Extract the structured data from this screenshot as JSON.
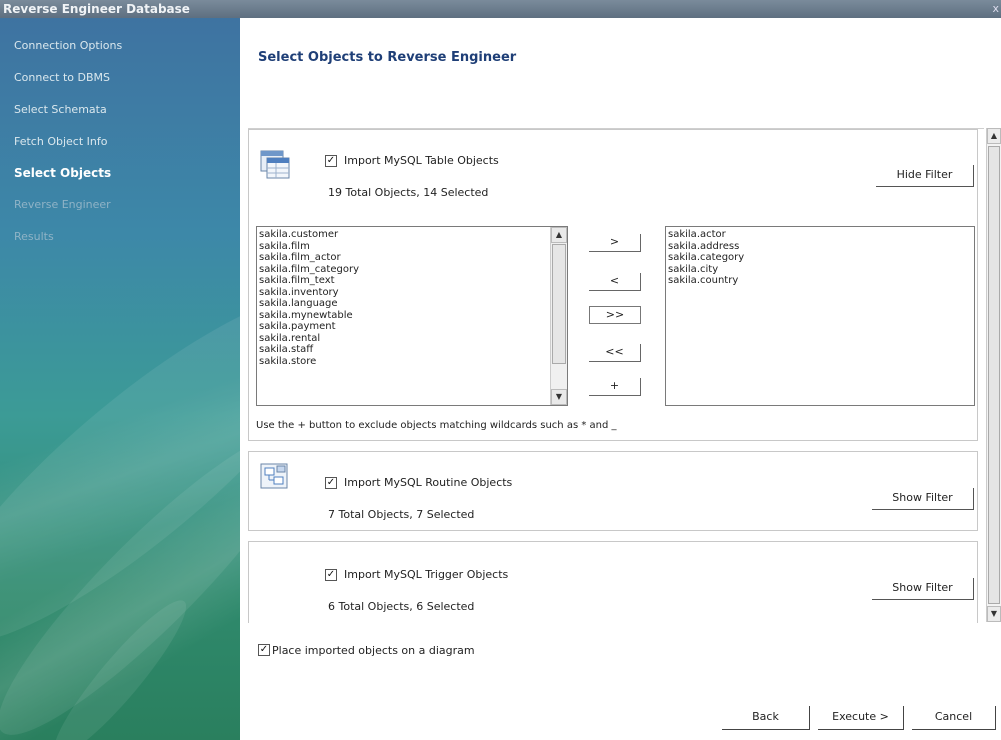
{
  "window": {
    "title": "Reverse Engineer Database",
    "close_glyph": "x"
  },
  "sidebar": {
    "items": [
      {
        "label": "Connection Options",
        "state": "done"
      },
      {
        "label": "Connect to DBMS",
        "state": "done"
      },
      {
        "label": "Select Schemata",
        "state": "done"
      },
      {
        "label": "Fetch Object Info",
        "state": "done"
      },
      {
        "label": "Select Objects",
        "state": "active"
      },
      {
        "label": "Reverse Engineer",
        "state": "pending"
      },
      {
        "label": "Results",
        "state": "pending"
      }
    ]
  },
  "main": {
    "title": "Select Objects to Reverse Engineer"
  },
  "tables_section": {
    "checkbox_label": "Import MySQL Table Objects",
    "checked": true,
    "count_text": "19 Total Objects, 14 Selected",
    "filter_button": "Hide Filter",
    "available": [
      "sakila.customer",
      "sakila.film",
      "sakila.film_actor",
      "sakila.film_category",
      "sakila.film_text",
      "sakila.inventory",
      "sakila.language",
      "sakila.mynewtable",
      "sakila.payment",
      "sakila.rental",
      "sakila.staff",
      "sakila.store"
    ],
    "selected": [
      "sakila.actor",
      "sakila.address",
      "sakila.category",
      "sakila.city",
      "sakila.country"
    ],
    "move_buttons": {
      "add": ">",
      "remove": "<",
      "add_all": ">>",
      "remove_all": "<<",
      "exclude": "+"
    },
    "hint": "Use the + button to exclude objects matching wildcards such as * and _"
  },
  "routines_section": {
    "checkbox_label": "Import MySQL Routine Objects",
    "checked": true,
    "count_text": "7 Total Objects, 7 Selected",
    "filter_button": "Show Filter"
  },
  "triggers_section": {
    "checkbox_label": "Import MySQL Trigger Objects",
    "checked": true,
    "count_text": "6 Total Objects, 6 Selected",
    "filter_button": "Show Filter"
  },
  "place_on_diagram": {
    "label": "Place imported objects on a diagram",
    "checked": true
  },
  "footer": {
    "back": "Back",
    "execute": "Execute >",
    "cancel": "Cancel"
  },
  "glyphs": {
    "check": "✓",
    "up": "▲",
    "down": "▼"
  }
}
